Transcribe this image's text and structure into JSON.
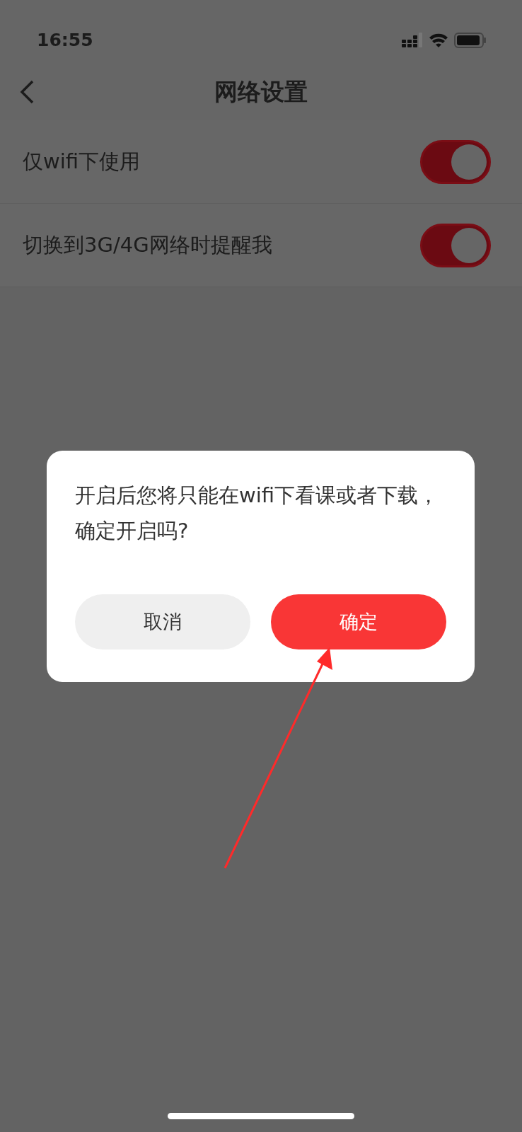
{
  "status_bar": {
    "time": "16:55"
  },
  "header": {
    "title": "网络设置"
  },
  "settings": [
    {
      "label": "仅wifi下使用",
      "on": true
    },
    {
      "label": "切换到3G/4G网络时提醒我",
      "on": true
    }
  ],
  "dialog": {
    "message": "开启后您将只能在wifi下看课或者下载，确定开启吗?",
    "buttons": [
      {
        "label": "取消",
        "kind": "cancel"
      },
      {
        "label": "确定",
        "kind": "confirm"
      }
    ]
  }
}
